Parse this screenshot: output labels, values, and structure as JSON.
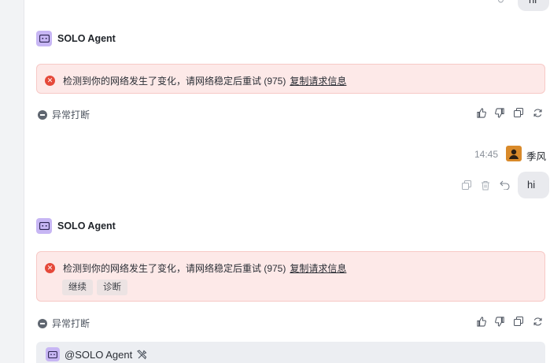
{
  "top_message": {
    "text": "hi"
  },
  "agent_name": "SOLO Agent",
  "error_block_1": {
    "message": "检测到你的网络发生了变化，请网络稳定后重试 (975)",
    "copy_link": "复制请求信息"
  },
  "abort_1": {
    "label": "异常打断"
  },
  "user_message": {
    "time": "14:45",
    "user_name": "季风",
    "text": "hi"
  },
  "error_block_2": {
    "message": "检测到你的网络发生了变化，请网络稳定后重试 (975)",
    "copy_link": "复制请求信息",
    "continue_label": "继续",
    "diagnose_label": "诊断"
  },
  "abort_2": {
    "label": "异常打断"
  },
  "input": {
    "mention": "@SOLO Agent"
  },
  "colors": {
    "agent_avatar": "#c7b6f4",
    "error_bg": "#fde9e8",
    "error_icon": "#e5493a",
    "user_avatar": "#d98a2a"
  }
}
